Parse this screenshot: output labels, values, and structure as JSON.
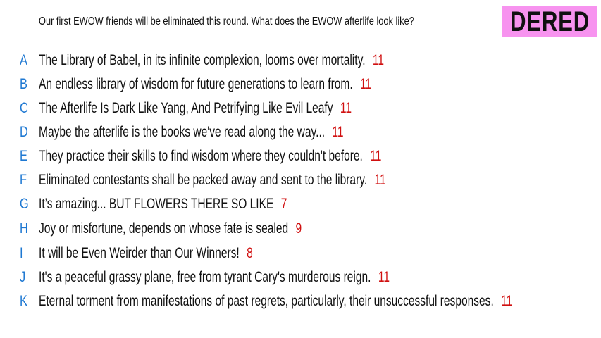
{
  "question": "Our first EWOW friends will be eliminated this round. What does the EWOW afterlife look like?",
  "badge": "DERED",
  "colors": {
    "badge_bg": "#f793ef",
    "letter": "#1e78d2",
    "score": "#d01010"
  },
  "responses": [
    {
      "letter": "A",
      "text": "The Library of Babel, in its infinite complexion, looms over mortality.",
      "score": "11"
    },
    {
      "letter": "B",
      "text": "An endless library of wisdom for future generations to learn from.",
      "score": "11"
    },
    {
      "letter": "C",
      "text": "The Afterlife Is Dark Like Yang, And Petrifying Like Evil Leafy",
      "score": "11"
    },
    {
      "letter": "D",
      "text": "Maybe the afterlife is the books we've read along the way...",
      "score": "11"
    },
    {
      "letter": "E",
      "text": "They practice their skills to find wisdom where they couldn't before.",
      "score": "11"
    },
    {
      "letter": "F",
      "text": "Eliminated contestants shall be packed away and sent to the library.",
      "score": "11"
    },
    {
      "letter": "G",
      "text": "It’s amazing... BUT FLOWERS THERE SO LIKE",
      "score": "7"
    },
    {
      "letter": "H",
      "text": "Joy or misfortune, depends on whose fate is sealed",
      "score": "9"
    },
    {
      "letter": "I",
      "text": "It will be Even Weirder than Our Winners!",
      "score": "8"
    },
    {
      "letter": "J",
      "text": "It's a peaceful grassy plane, free from tyrant Cary's murderous reign.",
      "score": "11"
    },
    {
      "letter": "K",
      "text": "Eternal torment from manifestations of past regrets, particularly, their unsuccessful responses.",
      "score": "11"
    }
  ]
}
